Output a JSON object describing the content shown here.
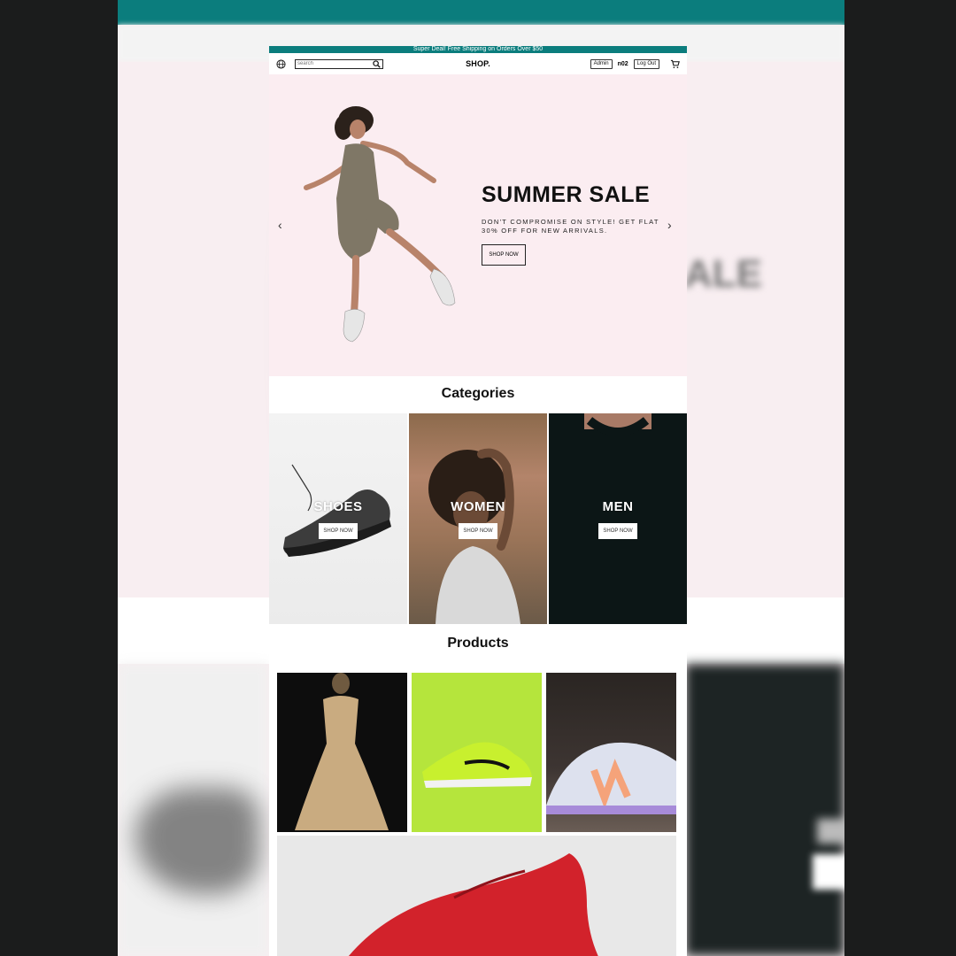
{
  "announcement": "Super Deal! Free Shipping on Orders Over $50",
  "nav": {
    "globe_icon": "globe-icon",
    "search_placeholder": "search",
    "search_icon": "search-icon",
    "logo": "SHOP.",
    "admin_label": "Admin",
    "username": "n02",
    "logout_label": "Log Out",
    "cart_icon": "cart-icon"
  },
  "hero": {
    "title": "SUMMER SALE",
    "description": "DON'T COMPROMISE ON STYLE! GET FLAT 30% OFF FOR NEW ARRIVALS.",
    "button": "SHOP NOW",
    "prev_icon": "chevron-left-icon",
    "next_icon": "chevron-right-icon"
  },
  "categories": {
    "title": "Categories",
    "items": [
      {
        "label": "SHOES",
        "button": "SHOP NOW"
      },
      {
        "label": "WOMEN",
        "button": "SHOP NOW"
      },
      {
        "label": "MEN",
        "button": "SHOP NOW"
      }
    ]
  },
  "products": {
    "title": "Products"
  },
  "colors": {
    "accent": "#0b7d7d",
    "hero_bg": "#fbedf1",
    "backdrop": "#1b1c1c"
  }
}
